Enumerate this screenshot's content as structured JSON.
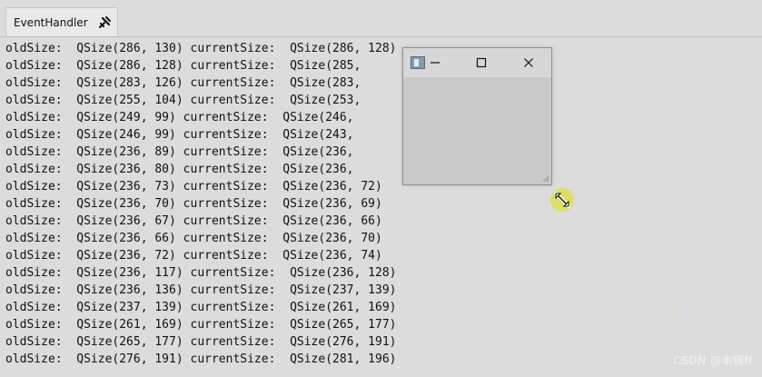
{
  "tab": {
    "title": "EventHandler",
    "pin_icon": "pin-close-icon"
  },
  "log_lines": [
    "oldSize:  QSize(286, 130) currentSize:  QSize(286, 128)",
    "oldSize:  QSize(286, 128) currentSize:  QSize(285,",
    "oldSize:  QSize(283, 126) currentSize:  QSize(283,",
    "oldSize:  QSize(255, 104) currentSize:  QSize(253,",
    "oldSize:  QSize(249, 99) currentSize:  QSize(246,",
    "oldSize:  QSize(246, 99) currentSize:  QSize(243,",
    "oldSize:  QSize(236, 89) currentSize:  QSize(236,",
    "oldSize:  QSize(236, 80) currentSize:  QSize(236,",
    "oldSize:  QSize(236, 73) currentSize:  QSize(236, 72)",
    "oldSize:  QSize(236, 70) currentSize:  QSize(236, 69)",
    "oldSize:  QSize(236, 67) currentSize:  QSize(236, 66)",
    "oldSize:  QSize(236, 66) currentSize:  QSize(236, 70)",
    "oldSize:  QSize(236, 72) currentSize:  QSize(236, 74)",
    "oldSize:  QSize(236, 117) currentSize:  QSize(236, 128)",
    "oldSize:  QSize(236, 136) currentSize:  QSize(237, 139)",
    "oldSize:  QSize(237, 139) currentSize:  QSize(261, 169)",
    "oldSize:  QSize(261, 169) currentSize:  QSize(265, 177)",
    "oldSize:  QSize(265, 177) currentSize:  QSize(276, 191)",
    "oldSize:  QSize(276, 191) currentSize:  QSize(281, 196)"
  ],
  "float_window": {
    "icon": "app-window-icon",
    "minimize_icon": "minimize-icon",
    "maximize_icon": "maximize-icon",
    "close_icon": "close-icon",
    "grip_icon": "size-grip-icon"
  },
  "cursor": {
    "icon": "diagonal-resize-cursor-icon",
    "highlight_color": "#dede28"
  },
  "watermark": "CSDN @丰铎ff",
  "colors": {
    "background": "#dcdcdc",
    "text": "#111111",
    "window_bg": "#c9c9c9"
  }
}
